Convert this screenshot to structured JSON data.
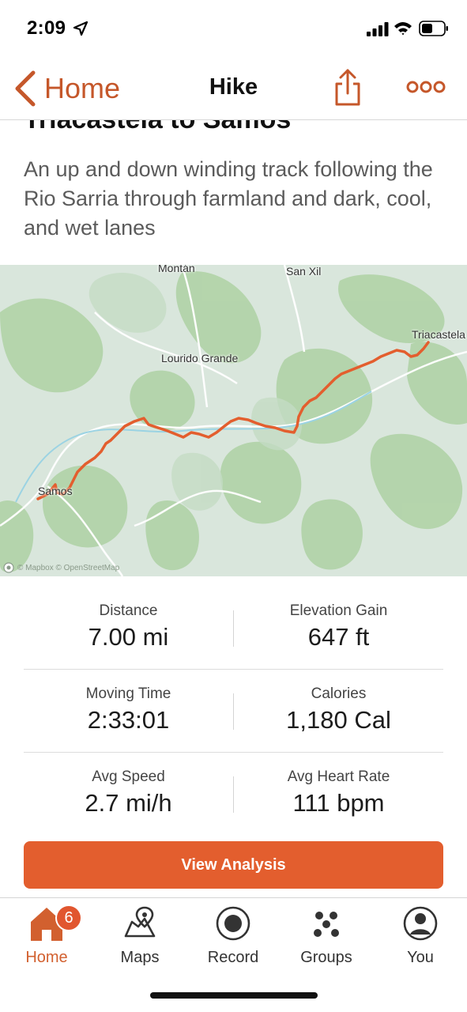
{
  "status_bar": {
    "time": "2:09"
  },
  "header": {
    "back_label": "Home",
    "title": "Hike"
  },
  "activity": {
    "title": "Triacastela to Samos",
    "description": "An up and down winding track following the Rio Sarria through farmland and dark, cool, and wet lanes"
  },
  "map": {
    "labels": {
      "montan": "Montán",
      "san_xil": "San Xil",
      "triacastela": "Triacastela",
      "lourido_grande": "Lourido Grande",
      "samos": "Samos"
    },
    "attribution": "© Mapbox © OpenStreetMap",
    "route_color": "#e35e2e"
  },
  "stats": {
    "distance": {
      "label": "Distance",
      "value": "7.00 mi"
    },
    "elevation_gain": {
      "label": "Elevation Gain",
      "value": "647 ft"
    },
    "moving_time": {
      "label": "Moving Time",
      "value": "2:33:01"
    },
    "calories": {
      "label": "Calories",
      "value": "1,180 Cal"
    },
    "avg_speed": {
      "label": "Avg Speed",
      "value": "2.7 mi/h"
    },
    "avg_heart_rate": {
      "label": "Avg Heart Rate",
      "value": "111 bpm"
    }
  },
  "actions": {
    "view_analysis": "View Analysis"
  },
  "tab_bar": {
    "home": {
      "label": "Home",
      "badge": "6",
      "icon": "home-icon"
    },
    "maps": {
      "label": "Maps",
      "icon": "maps-icon"
    },
    "record": {
      "label": "Record",
      "icon": "record-icon"
    },
    "groups": {
      "label": "Groups",
      "icon": "groups-icon"
    },
    "you": {
      "label": "You",
      "icon": "profile-icon"
    }
  },
  "colors": {
    "accent": "#e35e2e",
    "accent_text": "#c5572a"
  }
}
